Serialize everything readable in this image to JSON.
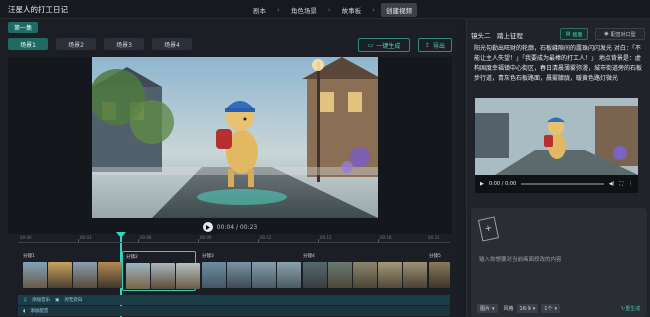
{
  "app": {
    "title": "汪星人的打工日记"
  },
  "steps": [
    {
      "label": "剧本",
      "active": false
    },
    {
      "label": "角色场景",
      "active": false
    },
    {
      "label": "故事板",
      "active": false
    },
    {
      "label": "创建视频",
      "active": true
    }
  ],
  "episode": {
    "label": "第一集"
  },
  "scenes": [
    {
      "label": "场景1",
      "active": true
    },
    {
      "label": "场景2",
      "active": false
    },
    {
      "label": "场景3",
      "active": false
    },
    {
      "label": "场景4",
      "active": false
    }
  ],
  "toolbar": {
    "generate_label": "一键生成",
    "export_label": "导出"
  },
  "player": {
    "time": "00:04 / 00:23"
  },
  "timeline": {
    "ticks": [
      "00:00",
      "00:03",
      "00:06",
      "00:09",
      "00:12",
      "00:15",
      "00:18",
      "00:21"
    ]
  },
  "clips": [
    {
      "label": "分镜1",
      "selected": false
    },
    {
      "label": "分镜2",
      "selected": true
    },
    {
      "label": "分镜3",
      "selected": false
    },
    {
      "label": "分镜4",
      "selected": false
    },
    {
      "label": "分镜5",
      "selected": false
    }
  ],
  "audio": {
    "music_label": "添加音乐",
    "sfx_label": "对无旁白",
    "voice_label": "添加配音"
  },
  "shot": {
    "title": "镜头二　踏上征程",
    "image_button": "画面",
    "voice_button": "配音对口型",
    "narration": "阳光勾勒出旺财的轮廓，石板缝隙间的露珠闪闪发光 对白：「不能让主人失望！」「我要成为最棒的打工人！」 地点背景是：虚构国度幸福镇中心街区，春日清晨薄雾弥漫，城市街道旁的石板步行道，青灰色石板路面，晨雾朦胧，暖黄色路灯微光",
    "video_time": "0:00 / 0:00"
  },
  "edit": {
    "placeholder": "输入你想要对当前画面修改的内容",
    "options": [
      {
        "label": "图片",
        "type": "select"
      },
      {
        "label": "风格",
        "type": "label"
      },
      {
        "label": "16:9",
        "type": "select"
      },
      {
        "label": "1个",
        "type": "select"
      }
    ],
    "generate_label": "重生成"
  },
  "colors": {
    "accent": "#37d3c0",
    "panel": "#20232a",
    "background": "#1a1d23"
  }
}
